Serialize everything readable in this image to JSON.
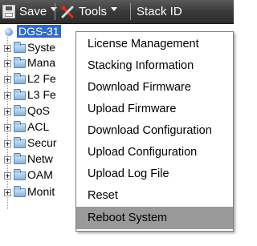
{
  "toolbar": {
    "save_label": "Save",
    "tools_label": "Tools",
    "stack_id_label": "Stack ID"
  },
  "tree": {
    "root_label": "DGS-31",
    "items": [
      {
        "label": "Syste"
      },
      {
        "label": "Mana"
      },
      {
        "label": "L2 Fe"
      },
      {
        "label": "L3 Fe"
      },
      {
        "label": "QoS"
      },
      {
        "label": "ACL"
      },
      {
        "label": "Secur"
      },
      {
        "label": "Netw"
      },
      {
        "label": "OAM"
      },
      {
        "label": "Monit"
      }
    ]
  },
  "tools_menu": {
    "items": [
      {
        "label": "License Management"
      },
      {
        "label": "Stacking Information"
      },
      {
        "label": "Download Firmware"
      },
      {
        "label": "Upload Firmware"
      },
      {
        "label": "Download Configuration"
      },
      {
        "label": "Upload Configuration"
      },
      {
        "label": "Upload Log File"
      },
      {
        "label": "Reset"
      },
      {
        "label": "Reboot System",
        "highlighted": true
      }
    ]
  },
  "colors": {
    "toolbar_bg": "#3a3a3a",
    "selection_bg": "#316ac5",
    "menu_highlight": "#9a9a9a"
  }
}
